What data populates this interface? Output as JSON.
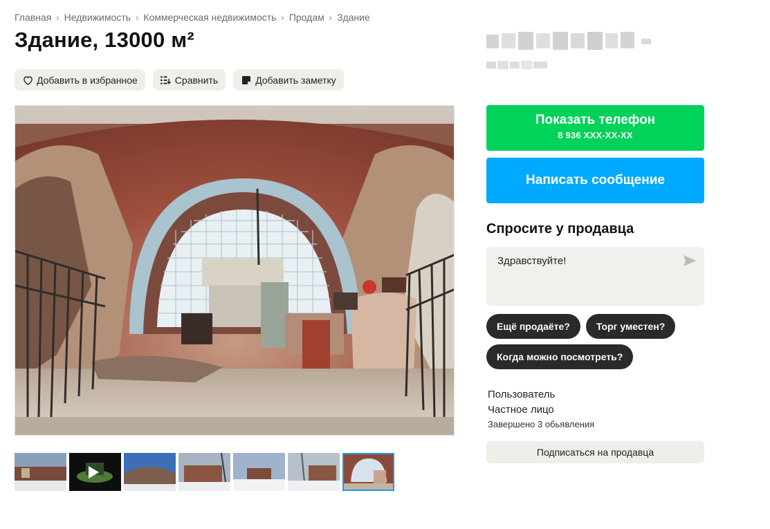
{
  "breadcrumb": [
    "Главная",
    "Недвижимость",
    "Коммерческая недвижимость",
    "Продам",
    "Здание"
  ],
  "listing": {
    "title": "Здание, 13000 м²"
  },
  "actions": {
    "favorite": "Добавить в избранное",
    "compare": "Сравнить",
    "note": "Добавить заметку"
  },
  "gallery": {
    "thumbnail_count": 7,
    "active_index": 6,
    "has_video_at": 1
  },
  "contact": {
    "show_phone": "Показать телефон",
    "phone_masked": "8 936 XXX-XX-XX",
    "write_message": "Написать сообщение"
  },
  "ask": {
    "title": "Спросите у продавца",
    "message_text": "Здравствуйте!",
    "quick_replies": [
      "Ещё продаёте?",
      "Торг уместен?",
      "Когда можно посмотреть?"
    ]
  },
  "seller": {
    "name": "Пользователь",
    "type": "Частное лицо",
    "stats": "Завершено 3 обьявления",
    "subscribe": "Подписаться на продавца"
  },
  "colors": {
    "phone_button": "#00d25a",
    "message_button": "#00aaff",
    "chip_bg": "#f0eee8",
    "pill_bg": "#2a2a2a",
    "active_thumb": "#1a9bf0"
  },
  "icons": {
    "favorite": "heart-icon",
    "compare": "compare-icon",
    "note": "note-icon",
    "send": "send-icon",
    "video": "play-icon"
  }
}
